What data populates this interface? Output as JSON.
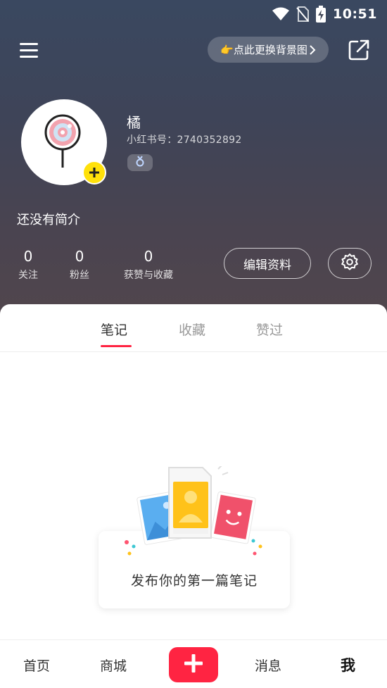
{
  "status_bar": {
    "time": "10:51"
  },
  "header": {
    "change_background_label": "👉点此更换背景图"
  },
  "profile": {
    "nickname": "橘",
    "user_id": "小红书号：2740352892",
    "bio": "还没有简介",
    "stats": [
      {
        "value": "0",
        "label": "关注"
      },
      {
        "value": "0",
        "label": "粉丝"
      },
      {
        "value": "0",
        "label": "获赞与收藏"
      }
    ],
    "edit_button_label": "编辑资料"
  },
  "tabs": [
    {
      "label": "笔记",
      "active": true
    },
    {
      "label": "收藏",
      "active": false
    },
    {
      "label": "赞过",
      "active": false
    }
  ],
  "empty_state": {
    "text": "发布你的第一篇笔记"
  },
  "bottom_nav": {
    "items": [
      {
        "label": "首页",
        "active": false
      },
      {
        "label": "商城",
        "active": false
      },
      {
        "label": "消息",
        "active": false
      },
      {
        "label": "我",
        "active": true
      }
    ]
  },
  "icons": {
    "menu": "hamburger-menu-icon",
    "share": "share-external-icon",
    "settings": "gear-icon",
    "publish": "plus-icon",
    "gender": "female-symbol-icon"
  },
  "colors": {
    "accent": "#ff2442",
    "avatar_plus_badge": "#ffe10a",
    "header_gradient_top": "#3a4860",
    "header_gradient_bottom": "#52464c"
  }
}
